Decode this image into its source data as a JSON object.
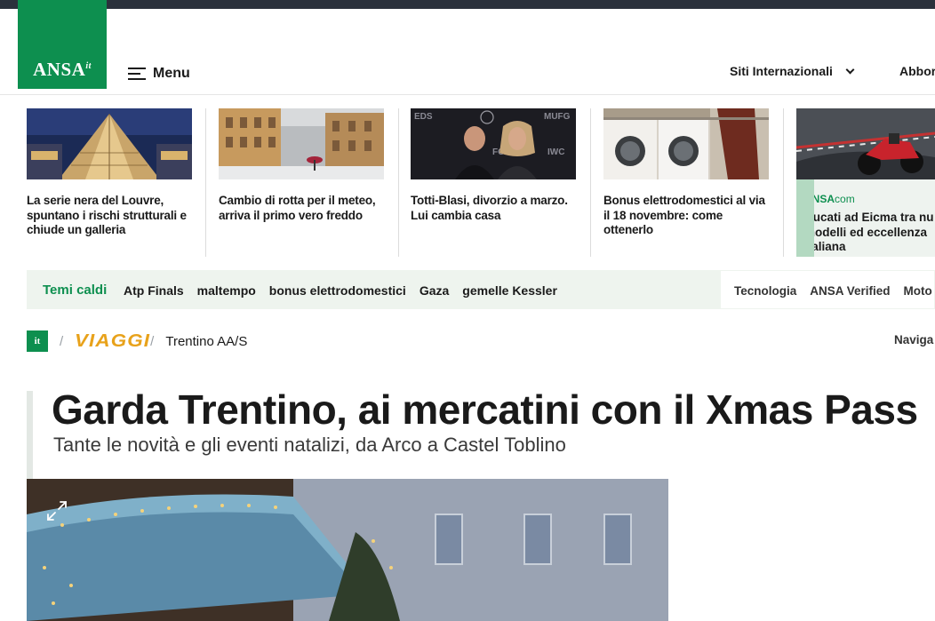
{
  "header": {
    "logo_text": "ANSA",
    "logo_suffix": "it",
    "menu_label": "Menu",
    "sites_label": "Siti Internazionali",
    "subscribe_label": "Abbor"
  },
  "news_strip": [
    {
      "title": "La serie nera del Louvre, spuntano i rischi strutturali e chiude un galleria"
    },
    {
      "title": "Cambio di rotta per il meteo, arriva il primo vero freddo"
    },
    {
      "title": "Totti-Blasi, divorzio a marzo. Lui cambia casa"
    },
    {
      "title": "Bonus elettrodomestici al via il 18 novembre: come ottenerlo"
    },
    {
      "brand_bold": "ANSA",
      "brand_light": "com",
      "title": "Ducati ad Eicma tra nu modelli ed eccellenza italiana"
    }
  ],
  "hot_topics": {
    "label": "Temi caldi",
    "items": [
      "Atp Finals",
      "maltempo",
      "bonus elettrodomestici",
      "Gaza",
      "gemelle Kessler"
    ],
    "sections": [
      "Tecnologia",
      "ANSA Verified",
      "Moto"
    ]
  },
  "breadcrumb": {
    "home_icon": "it",
    "section": "VIAGGI",
    "subsection": "Trentino AA/S",
    "naviga": "Naviga"
  },
  "article": {
    "headline": "Garda Trentino, ai mercatini con il Xmas Pass",
    "subheadline": "Tante le novità e gli eventi natalizi, da Arco a Castel Toblino"
  },
  "colors": {
    "brand_green": "#0d8f4f",
    "viaggi_orange": "#e8a21b",
    "topbar": "#2b313c"
  }
}
